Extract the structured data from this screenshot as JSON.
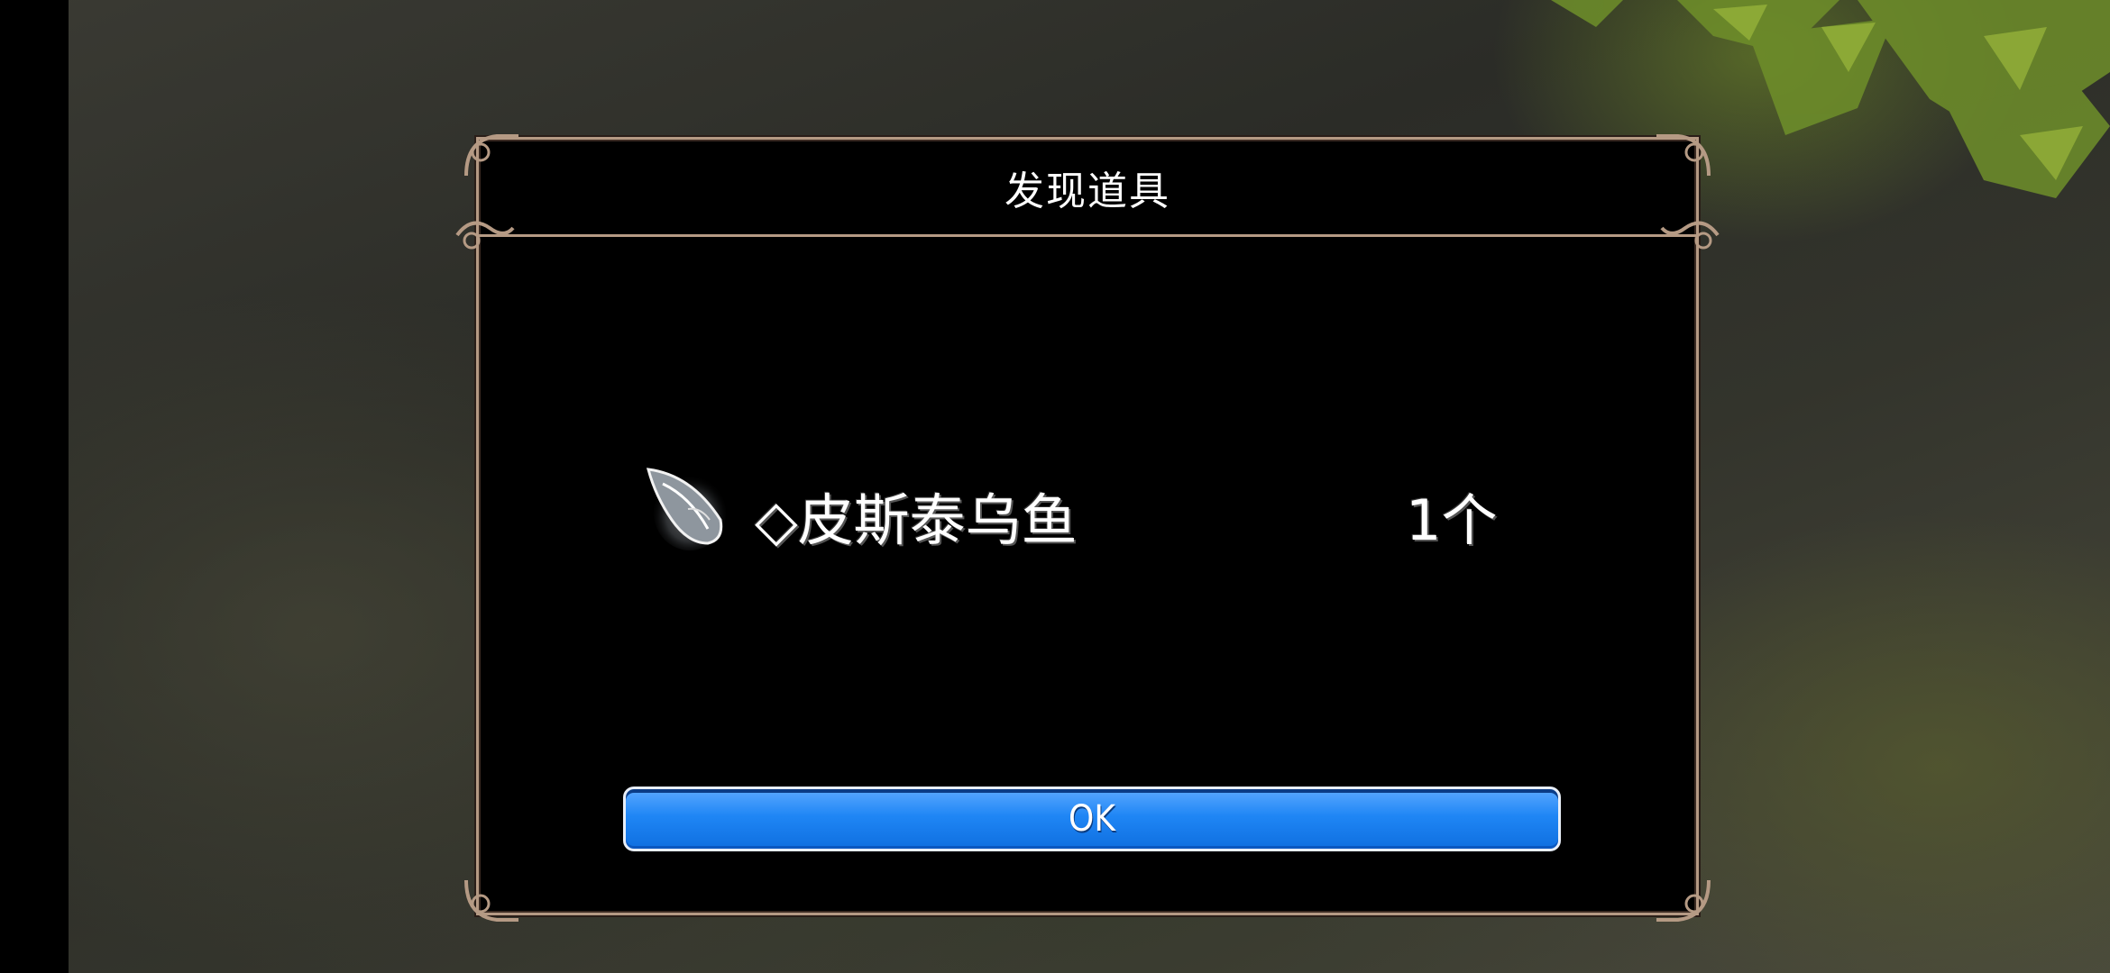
{
  "dialog": {
    "title": "发现道具",
    "item": {
      "icon": "crystal-shard-icon",
      "name": "◇皮斯泰乌鱼",
      "quantity": "1个"
    },
    "ok_label": "OK"
  },
  "colors": {
    "frame": "#b59a84",
    "dialog_bg": "#000000",
    "button_blue": "#1f86f5",
    "text": "#ffffff"
  }
}
